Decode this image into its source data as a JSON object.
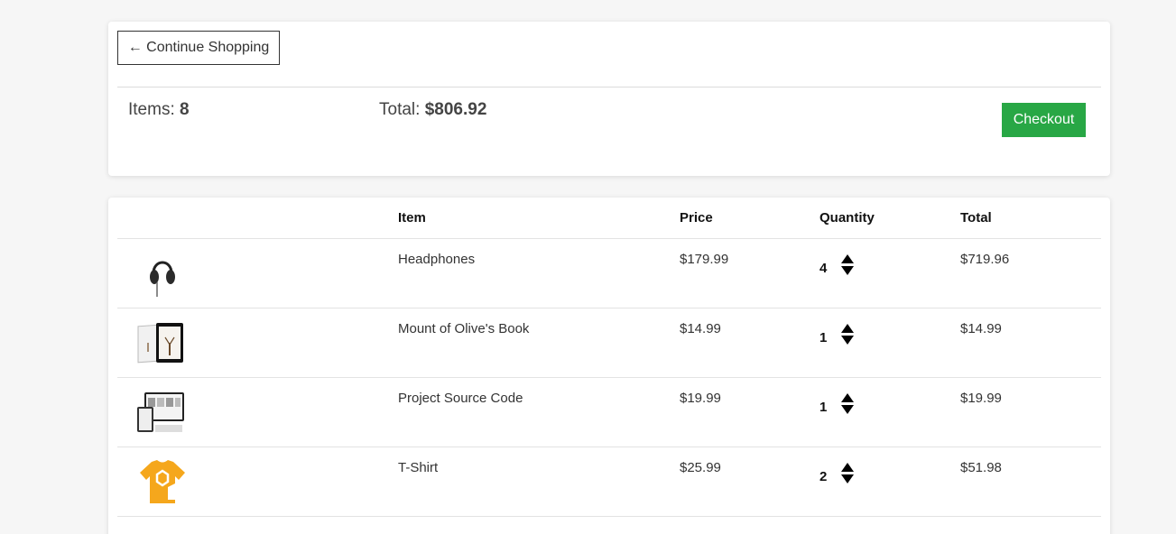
{
  "summary": {
    "continue_label": "← Continue Shopping",
    "items_label": "Items:",
    "items_count": "8",
    "total_label": "Total:",
    "total_value": "$806.92",
    "checkout_label": "Checkout"
  },
  "cart": {
    "headers": {
      "item": "Item",
      "price": "Price",
      "quantity": "Quantity",
      "total": "Total"
    },
    "rows": [
      {
        "image": "headphones-image",
        "name": "Headphones",
        "price": "$179.99",
        "quantity": "4",
        "total": "$719.96"
      },
      {
        "image": "book-image",
        "name": "Mount of Olive's Book",
        "price": "$14.99",
        "quantity": "1",
        "total": "$14.99"
      },
      {
        "image": "source-code-image",
        "name": "Project Source Code",
        "price": "$19.99",
        "quantity": "1",
        "total": "$19.99"
      },
      {
        "image": "tshirt-image",
        "name": "T-Shirt",
        "price": "$25.99",
        "quantity": "2",
        "total": "$51.98"
      }
    ]
  },
  "colors": {
    "checkout": "#28a745",
    "background": "#f6f6f6",
    "tshirt": "#f5a71c"
  }
}
